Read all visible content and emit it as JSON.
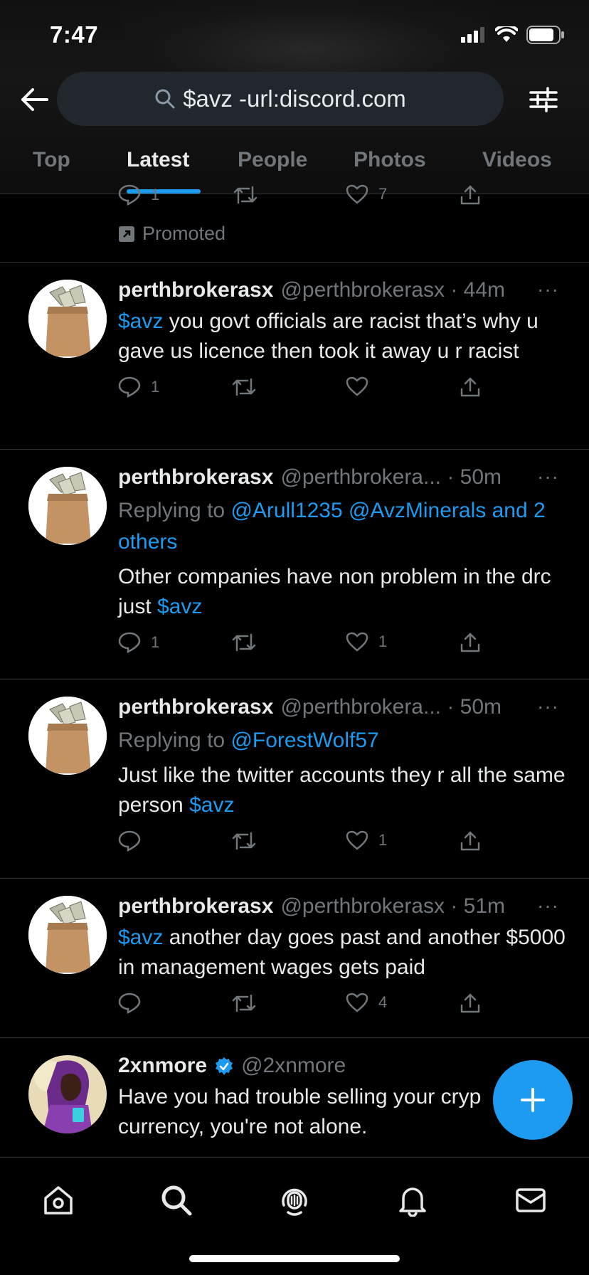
{
  "status_bar": {
    "time": "7:47"
  },
  "search": {
    "query": "$avz -url:discord.com"
  },
  "tabs": [
    {
      "label": "Top",
      "active": false
    },
    {
      "label": "Latest",
      "active": true
    },
    {
      "label": "People",
      "active": false
    },
    {
      "label": "Photos",
      "active": false
    },
    {
      "label": "Videos",
      "active": false
    }
  ],
  "promoted": {
    "reply_count": "1",
    "like_count": "7",
    "label": "Promoted"
  },
  "tweets": [
    {
      "name": "perthbrokerasx",
      "handle": "@perthbrokerasx · 44m",
      "cashtag": "$avz",
      "text": " you govt officials are racist that’s why u gave us licence then took it away u r racist",
      "reply_count": "1",
      "like_count": ""
    },
    {
      "name": "perthbrokerasx",
      "handle": "@perthbrokera... · 50m",
      "replying_prefix": "Replying to ",
      "replying_to": "@Arull1235 @AvzMinerals and 2 others",
      "text": "Other companies have non problem in the drc just ",
      "cashtag": "$avz",
      "reply_count": "1",
      "like_count": "1"
    },
    {
      "name": "perthbrokerasx",
      "handle": "@perthbrokera... · 50m",
      "replying_prefix": "Replying to ",
      "replying_to": "@ForestWolf57",
      "text": "Just like the twitter accounts they r all the same person ",
      "cashtag": "$avz",
      "reply_count": "",
      "like_count": "1"
    },
    {
      "name": "perthbrokerasx",
      "handle": "@perthbrokerasx · 51m",
      "cashtag": "$avz",
      "text": " another day goes past and another $5000 in management wages gets paid",
      "reply_count": "",
      "like_count": "4"
    },
    {
      "name": "2xnmore",
      "handle": "@2xnmore",
      "verified": true,
      "text": "Have you had trouble selling your cryp currency, you're not alone."
    }
  ],
  "more_label": "···",
  "colors": {
    "accent": "#1d9bf0",
    "muted": "#71767b",
    "text": "#e7e9ea",
    "divider": "#2f3336"
  }
}
